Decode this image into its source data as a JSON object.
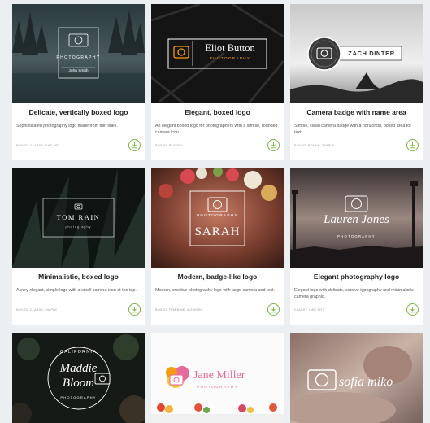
{
  "cards": [
    {
      "title": "Delicate, vertically boxed logo",
      "desc": "Sophisticated photography logo made from thin lines.",
      "tags": "BOXED, CLASSY, LINE ART",
      "logo": {
        "line1": "PHOTOGRAPHY",
        "line2": "John Smith"
      }
    },
    {
      "title": "Elegant, boxed logo",
      "desc": "An elegant boxed logo for photographers with a simple, rounded camera icon.",
      "tags": "BOXED, PLAYFUL",
      "logo": {
        "line1": "Eliot Button",
        "line2": "PHOTOGRAPHY"
      }
    },
    {
      "title": "Camera badge with name area",
      "desc": "Simple, clean camera badge with a horizontal, boxed area for text.",
      "tags": "BOXED, ROUND, SIMPLE",
      "logo": {
        "line1": "ZACH DINTER"
      }
    },
    {
      "title": "Minimalistic, boxed logo",
      "desc": "A very elegant, simple logo with a small camera icon at the top.",
      "tags": "BOXED, CLASSY, SIMPLE",
      "logo": {
        "line1": "TOM RAIN",
        "line2": "photography"
      }
    },
    {
      "title": "Modern, badge-like logo",
      "desc": "Modern, creative photography logo with large camera and text.",
      "tags": "BOXED, FEMININE, MODERN",
      "logo": {
        "line1": "PHOTOGRAPHY",
        "line2": "SARAH"
      }
    },
    {
      "title": "Elegant photography logo",
      "desc": "Elegant logo with delicate, cursive typography and minimalistic camera graphic.",
      "tags": "CLASSY, LINE ART",
      "logo": {
        "line1": "Lauren Jones",
        "line2": "PHOTOGRAPHY"
      }
    },
    {
      "logo": {
        "line1": "CALIFORNIA",
        "line2": "Maddie",
        "line3": "Bloom",
        "line4": "PHOTOGRAPHY"
      }
    },
    {
      "logo": {
        "line1": "Jane Miller",
        "line2": "PHOTOGRAPHY"
      }
    },
    {
      "logo": {
        "line1": "sofia miko"
      }
    }
  ],
  "icons": {
    "download": "download-arrow-icon",
    "camera": "camera-icon"
  },
  "colors": {
    "accent": "#7cb342",
    "orange": "#f39c12",
    "pink": "#e66a9a"
  }
}
